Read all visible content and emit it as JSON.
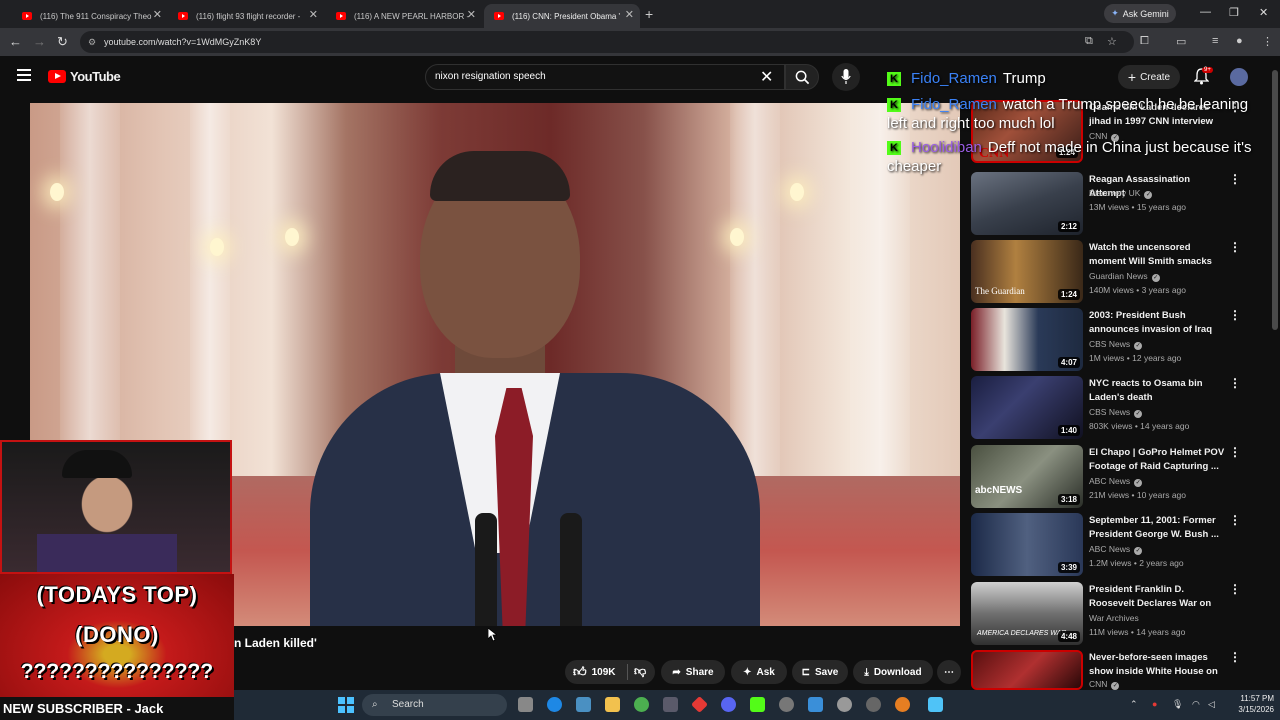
{
  "browser": {
    "tabs": [
      {
        "title": "(116) The 911 Conspiracy Theo"
      },
      {
        "title": "(116) flight 93 flight recorder -"
      },
      {
        "title": "(116) A NEW PEARL HARBOR -"
      },
      {
        "title": "(116) CNN: President Obama '",
        "active": true
      }
    ],
    "ask_gemini": "Ask Gemini",
    "url": "youtube.com/watch?v=1WdMGyZnK8Y"
  },
  "youtube": {
    "logo_text": "YouTube",
    "search_query": "nixon resignation speech",
    "create_label": "Create",
    "notification_badge": "9+"
  },
  "video": {
    "title_visible": "n Laden killed'",
    "likes": "109K",
    "share_label": "Share",
    "ask_label": "Ask",
    "save_label": "Save",
    "download_label": "Download"
  },
  "chat": [
    {
      "user": "Fido_Ramen",
      "user_color": "#3b82f6",
      "message": "Trump"
    },
    {
      "user": "Fido_Ramen",
      "user_color": "#3b82f6",
      "message": "watch a Trump speech he be leaning left and right too much lol"
    },
    {
      "user": "Hoolidiban",
      "user_color": "#9b5de5",
      "message": "Deff not made in China just because it's cheaper"
    }
  ],
  "overlay": {
    "dono_line1": "(TODAYS TOP)",
    "dono_line2": "(DONO)",
    "dono_line3": "???????????????",
    "new_subscriber": "NEW SUBSCRIBER - Jack"
  },
  "recommendations": [
    {
      "title": "Osama bin Laden declares jihad in 1997 CNN interview",
      "channel": "CNN",
      "meta": "",
      "duration": "1:24"
    },
    {
      "title": "Reagan Assassination Attempt",
      "channel": "Discovery UK",
      "meta": "13M views • 15 years ago",
      "duration": "2:12"
    },
    {
      "title": "Watch the uncensored moment Will Smith smacks Chris Rock ...",
      "channel": "Guardian News",
      "meta": "140M views • 3 years ago",
      "duration": "1:24"
    },
    {
      "title": "2003: President Bush announces invasion of Iraq",
      "channel": "CBS News",
      "meta": "1M views • 12 years ago",
      "duration": "4:07"
    },
    {
      "title": "NYC reacts to Osama bin Laden's death",
      "channel": "CBS News",
      "meta": "803K views • 14 years ago",
      "duration": "1:40"
    },
    {
      "title": "El Chapo | GoPro Helmet POV Footage of Raid Capturing ...",
      "channel": "ABC News",
      "meta": "21M views • 10 years ago",
      "duration": "3:18"
    },
    {
      "title": "September 11, 2001: Former President George W. Bush ...",
      "channel": "ABC News",
      "meta": "1.2M views • 2 years ago",
      "duration": "3:39"
    },
    {
      "title": "President Franklin D. Roosevelt Declares War on Japan (Full ...",
      "channel": "War Archives",
      "meta": "11M views • 14 years ago",
      "duration": "4:48"
    },
    {
      "title": "Never-before-seen images show inside White House on t...",
      "channel": "CNN",
      "meta": "",
      "duration": ""
    }
  ],
  "thumb_labels": {
    "cnn": "CNN",
    "guardian": "The Guardian",
    "abcnews": "abcNEWS",
    "roosevelt": "AMERICA DECLARES WAR"
  },
  "taskbar": {
    "search_placeholder": "Search",
    "time": "11:57 PM",
    "date": "3/15/2026"
  }
}
